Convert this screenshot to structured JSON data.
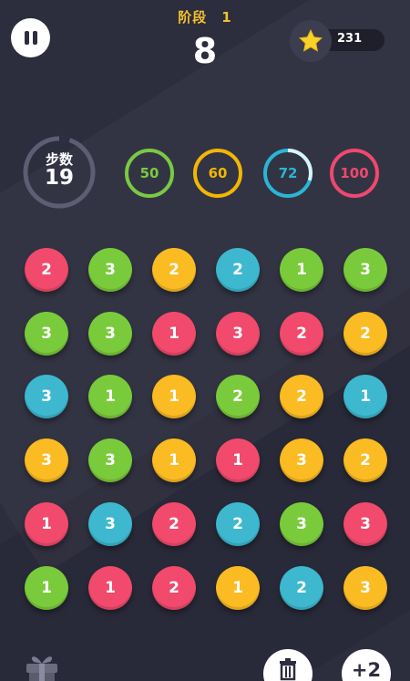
{
  "header": {
    "stage_label": "阶段",
    "stage_value": "1",
    "level": "8",
    "stars": "231"
  },
  "moves": {
    "label": "步数",
    "value": "19",
    "remaining_fraction": 0.95
  },
  "goals": [
    {
      "value": "50",
      "color": "#7ac943",
      "progress": 0
    },
    {
      "value": "60",
      "color": "#f2b705",
      "progress": 0
    },
    {
      "value": "72",
      "color": "#29b6d6",
      "progress": 0.3
    },
    {
      "value": "100",
      "color": "#f0486e",
      "progress": 0
    }
  ],
  "colors": {
    "red": "#f14a6c",
    "green": "#7acb3b",
    "yellow": "#fbbb22",
    "blue": "#3db8cf"
  },
  "board": [
    [
      {
        "c": "red",
        "v": "2"
      },
      {
        "c": "green",
        "v": "3"
      },
      {
        "c": "yellow",
        "v": "2"
      },
      {
        "c": "blue",
        "v": "2"
      },
      {
        "c": "green",
        "v": "1"
      },
      {
        "c": "green",
        "v": "3"
      }
    ],
    [
      {
        "c": "green",
        "v": "3"
      },
      {
        "c": "green",
        "v": "3"
      },
      {
        "c": "red",
        "v": "1"
      },
      {
        "c": "red",
        "v": "3"
      },
      {
        "c": "red",
        "v": "2"
      },
      {
        "c": "yellow",
        "v": "2"
      }
    ],
    [
      {
        "c": "blue",
        "v": "3"
      },
      {
        "c": "green",
        "v": "1"
      },
      {
        "c": "yellow",
        "v": "1"
      },
      {
        "c": "green",
        "v": "2"
      },
      {
        "c": "yellow",
        "v": "2"
      },
      {
        "c": "blue",
        "v": "1"
      }
    ],
    [
      {
        "c": "yellow",
        "v": "3"
      },
      {
        "c": "green",
        "v": "3"
      },
      {
        "c": "yellow",
        "v": "1"
      },
      {
        "c": "red",
        "v": "1"
      },
      {
        "c": "yellow",
        "v": "3"
      },
      {
        "c": "yellow",
        "v": "2"
      }
    ],
    [
      {
        "c": "red",
        "v": "1"
      },
      {
        "c": "blue",
        "v": "3"
      },
      {
        "c": "red",
        "v": "2"
      },
      {
        "c": "blue",
        "v": "2"
      },
      {
        "c": "green",
        "v": "3"
      },
      {
        "c": "red",
        "v": "3"
      }
    ],
    [
      {
        "c": "green",
        "v": "1"
      },
      {
        "c": "red",
        "v": "1"
      },
      {
        "c": "red",
        "v": "2"
      },
      {
        "c": "yellow",
        "v": "1"
      },
      {
        "c": "blue",
        "v": "2"
      },
      {
        "c": "yellow",
        "v": "3"
      }
    ]
  ],
  "buttons": {
    "plus_label": "+2"
  }
}
